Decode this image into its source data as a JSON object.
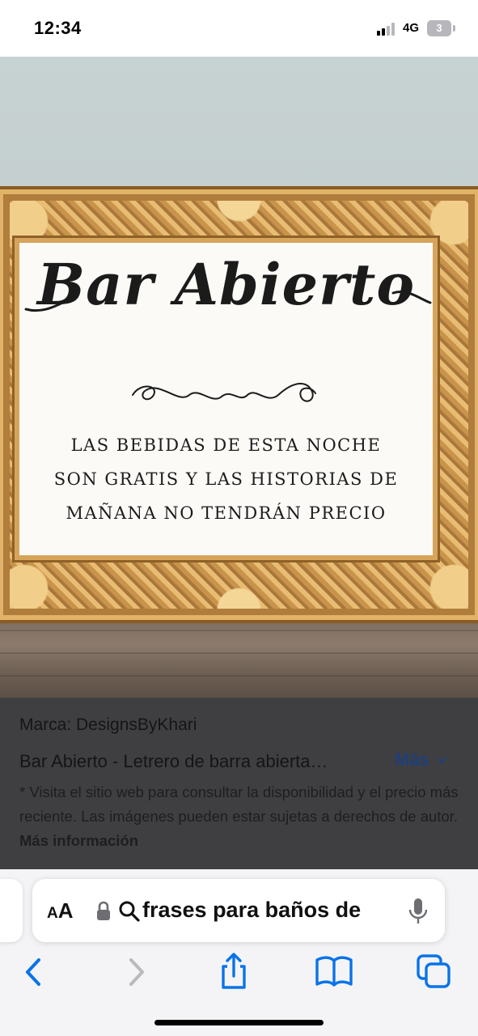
{
  "status_bar": {
    "time": "12:34",
    "network": "4G",
    "battery": "3"
  },
  "photo": {
    "sign": {
      "title": "Bar Abierto",
      "lines": [
        "LAS BEBIDAS DE ESTA NOCHE",
        "SON GRATIS Y LAS HISTORIAS DE",
        "MAÑANA NO TENDRÁN PRECIO"
      ]
    }
  },
  "caption": {
    "brand": "Marca: DesignsByKhari",
    "title": "Bar Abierto - Letrero de barra abierta…",
    "more_label": "Más",
    "disclaimer": "* Visita el sitio web para consultar la disponibilidad y el precio más reciente. Las imágenes pueden estar sujetas a derechos de autor.",
    "more_info_label": "Más información"
  },
  "browser": {
    "aa_label_small": "A",
    "aa_label_large": "A",
    "address": "frases para baños de",
    "icons": {
      "back": "chevron-left-icon",
      "forward": "chevron-right-icon",
      "share": "share-icon",
      "bookmarks": "book-icon",
      "tabs": "tabs-icon",
      "lock": "lock-icon",
      "search": "search-icon",
      "mic": "microphone-icon"
    },
    "colors": {
      "accent": "#0a73e8",
      "disabled": "#b9b9be"
    }
  }
}
